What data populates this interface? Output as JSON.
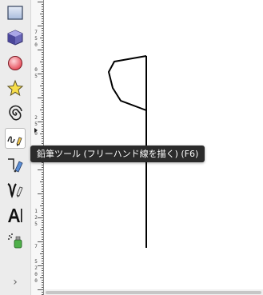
{
  "tooltip": {
    "text": "鉛筆ツール (フリーハンド線を描く) (F6)"
  },
  "toolbox": {
    "tools": [
      {
        "name": "rectangle-tool-icon"
      },
      {
        "name": "3d-box-tool-icon"
      },
      {
        "name": "ellipse-tool-icon"
      },
      {
        "name": "star-tool-icon"
      },
      {
        "name": "spiral-tool-icon"
      },
      {
        "name": "pencil-tool-icon",
        "active": true
      },
      {
        "name": "pen-tool-icon"
      },
      {
        "name": "calligraphy-tool-icon"
      },
      {
        "name": "text-tool-icon"
      },
      {
        "name": "spray-tool-icon"
      }
    ],
    "expand_icon": "›"
  },
  "ruler": {
    "labels": [
      "7",
      "5",
      "0",
      "0",
      "5",
      "2",
      "5",
      "0",
      "1",
      "2",
      "5",
      "7",
      "5",
      "2",
      "0",
      "0"
    ]
  },
  "colors": {
    "toolbox_bg": "#ececec",
    "tooltip_bg": "#2b2b2b",
    "stroke": "#000000"
  }
}
